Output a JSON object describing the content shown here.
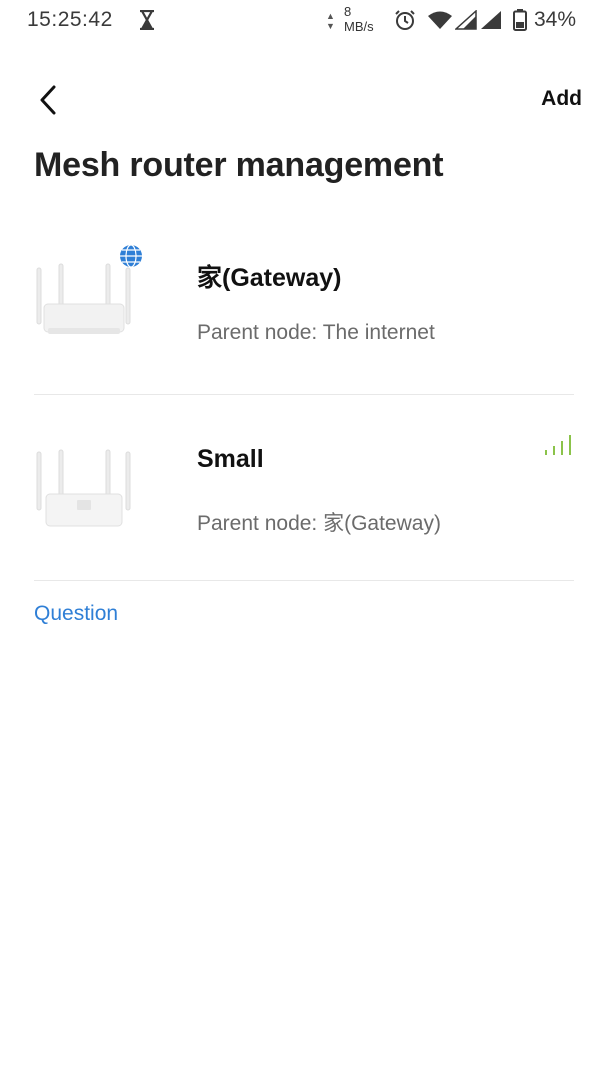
{
  "status_bar": {
    "time": "15:25:42",
    "net_speed_value": "8",
    "net_speed_unit": "MB/s",
    "battery": "34%",
    "icons": [
      "hourglass-icon",
      "data-arrows-icon",
      "alarm-icon",
      "wifi-icon",
      "signal-icon",
      "signal-icon",
      "battery-icon"
    ]
  },
  "header": {
    "back_icon": "chevron-left-icon",
    "add_label": "Add",
    "title": "Mesh router management"
  },
  "routers": [
    {
      "name": "家(Gateway)",
      "parent_node": "Parent node: The internet",
      "badge_icon": "globe-icon",
      "badge_color": "#2f7fd6"
    },
    {
      "name": "Small",
      "parent_node": "Parent node: 家(Gateway)",
      "signal_icon": "signal-strength-icon",
      "signal_color": "#8bc34a"
    }
  ],
  "footer": {
    "question_label": "Question",
    "link_color": "#2f7fd6"
  }
}
